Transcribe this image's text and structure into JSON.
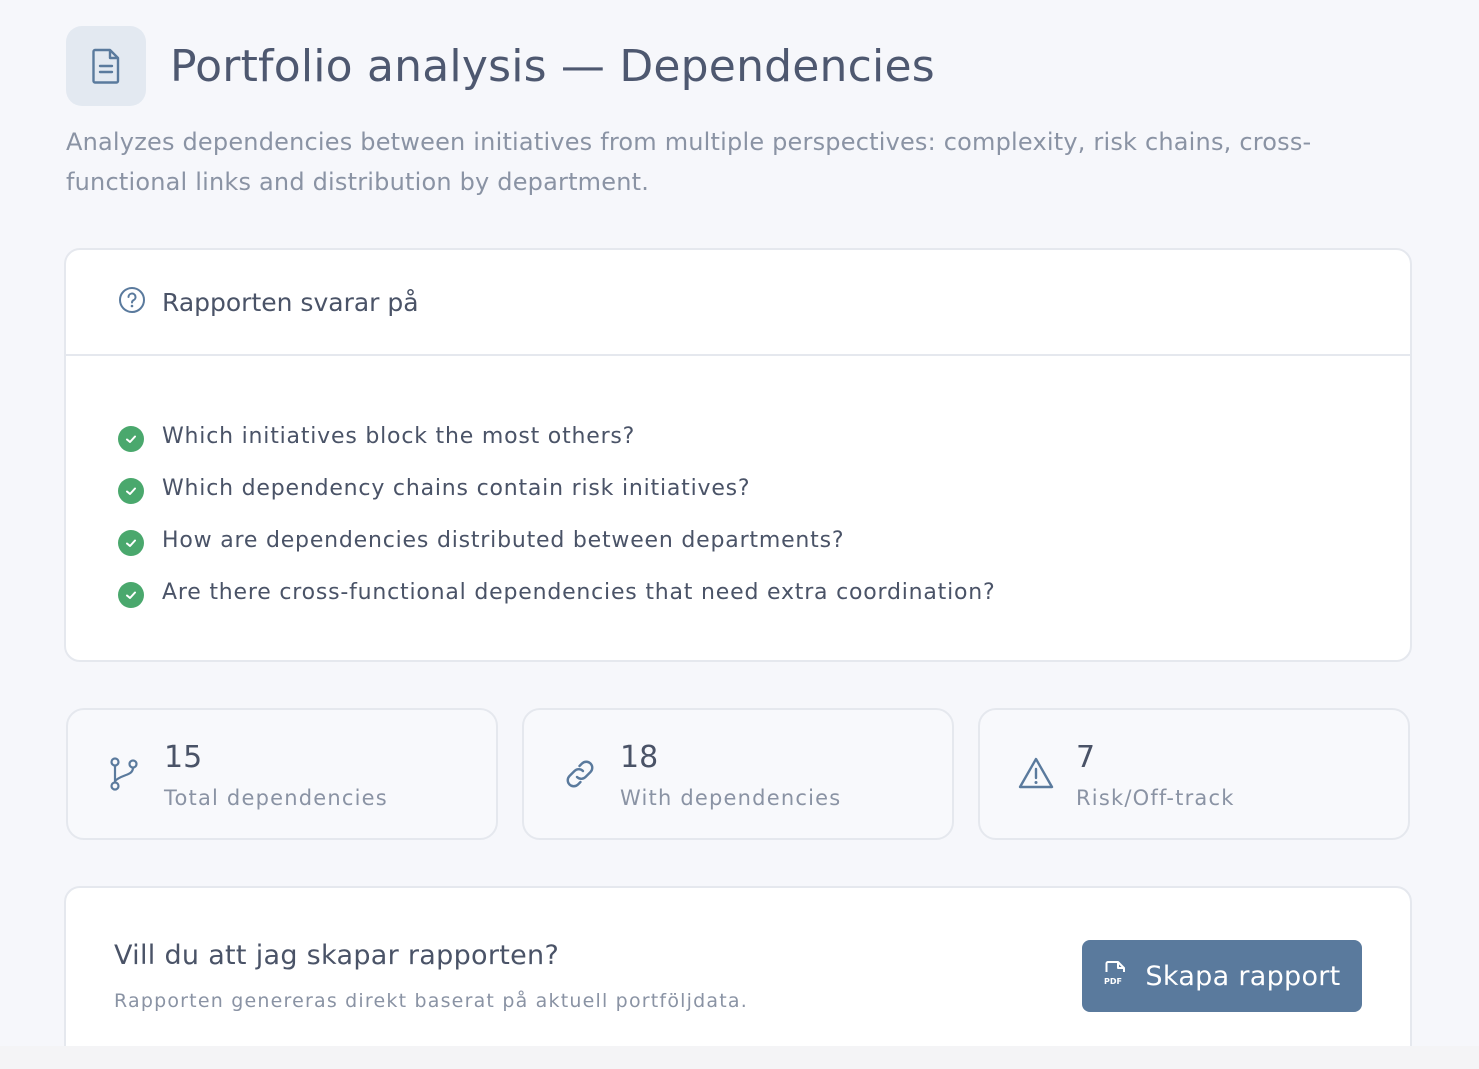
{
  "header": {
    "icon": "document-icon",
    "title": "Portfolio analysis — Dependencies",
    "subtitle": "Analyzes dependencies between initiatives from multiple perspectives: complexity, risk chains, cross-functional links and distribution by department."
  },
  "questions": {
    "icon": "help-circle-icon",
    "title": "Rapporten svarar på",
    "items": [
      {
        "label": "Which initiatives block the most others?",
        "icon": "check-circle-icon"
      },
      {
        "label": "Which dependency chains contain risk initiatives?",
        "icon": "check-circle-icon"
      },
      {
        "label": "How are dependencies distributed between departments?",
        "icon": "check-circle-icon"
      },
      {
        "label": "Are there cross-functional dependencies that need extra coordination?",
        "icon": "check-circle-icon"
      }
    ]
  },
  "stats": [
    {
      "value": "15",
      "label": "Total dependencies",
      "icon": "git-branch-icon"
    },
    {
      "value": "18",
      "label": "With dependencies",
      "icon": "link-icon"
    },
    {
      "value": "7",
      "label": "Risk/Off-track",
      "icon": "warning-icon"
    }
  ],
  "cta": {
    "title": "Vill du att jag skapar rapporten?",
    "subtitle": "Rapporten genereras direkt baserat på aktuell portföljdata.",
    "button_label": "Skapa rapport",
    "button_icon": "pdf-file-icon"
  },
  "colors": {
    "background": "#f6f7fb",
    "accent": "#5a7a9d",
    "success": "#4aa86d",
    "text": "#4a5367",
    "muted": "#8a93a4"
  }
}
